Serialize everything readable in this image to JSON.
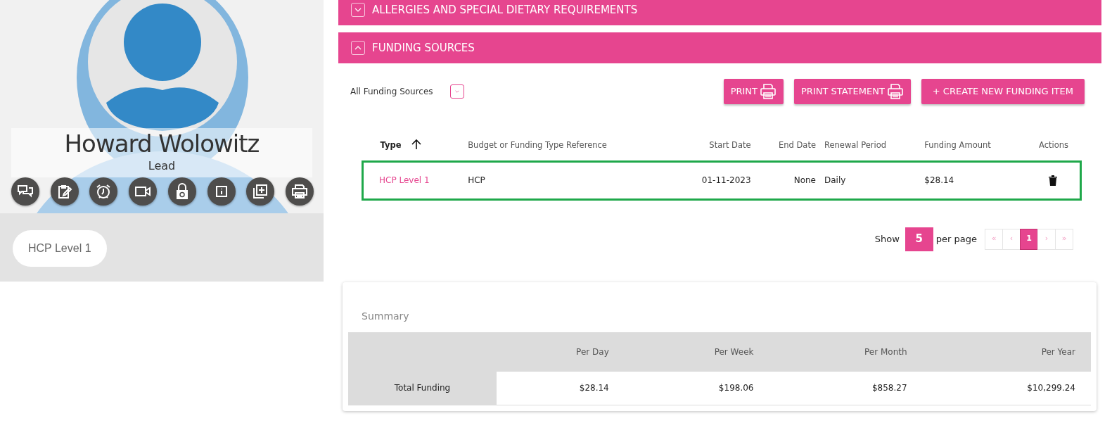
{
  "profile": {
    "name": "Howard Wolowitz",
    "role": "Lead",
    "tags": [
      "HCP Level 1"
    ]
  },
  "sections": [
    {
      "title": "ALLERGIES AND SPECIAL DIETARY REQUIREMENTS",
      "expanded": false
    },
    {
      "title": "FUNDING SOURCES",
      "expanded": true
    }
  ],
  "funding": {
    "filter": "All Funding Sources",
    "buttons": [
      {
        "label": "PRINT",
        "kind": "print"
      },
      {
        "label": "PRINT STATEMENT",
        "kind": "print"
      },
      {
        "label": "+ CREATE NEW FUNDING ITEM",
        "kind": "plain"
      }
    ],
    "table": {
      "columns": [
        {
          "label": "Type",
          "sorted": true
        },
        {
          "label": "Budget or Funding Type Reference",
          "sorted": false
        },
        {
          "label": "Start Date",
          "sorted": false
        },
        {
          "label": "End Date",
          "sorted": false
        },
        {
          "label": "Renewal Period",
          "sorted": false
        },
        {
          "label": "Funding Amount",
          "sorted": false
        },
        {
          "label": "Actions",
          "sorted": false
        }
      ],
      "rows": [
        {
          "selected": true,
          "cells": [
            "HCP Level 1",
            "HCP",
            "01-11-2023",
            "None",
            "Daily",
            "$28.14"
          ]
        }
      ]
    },
    "pagination": {
      "show_label": "Show",
      "page_size": "5",
      "per_page_label": "per page",
      "pages": [
        {
          "label": "«",
          "selected": false
        },
        {
          "label": "‹",
          "selected": false
        },
        {
          "label": "1",
          "selected": true
        },
        {
          "label": "›",
          "selected": false
        },
        {
          "label": "»",
          "selected": false
        }
      ]
    }
  },
  "summary": {
    "title": "Summary",
    "columns": [
      "Per Day",
      "Per Week",
      "Per Month",
      "Per Year"
    ],
    "rows": [
      {
        "label": "Total Funding",
        "values": [
          "$28.14",
          "$198.06",
          "$858.27",
          "$10,299.24"
        ]
      }
    ]
  }
}
